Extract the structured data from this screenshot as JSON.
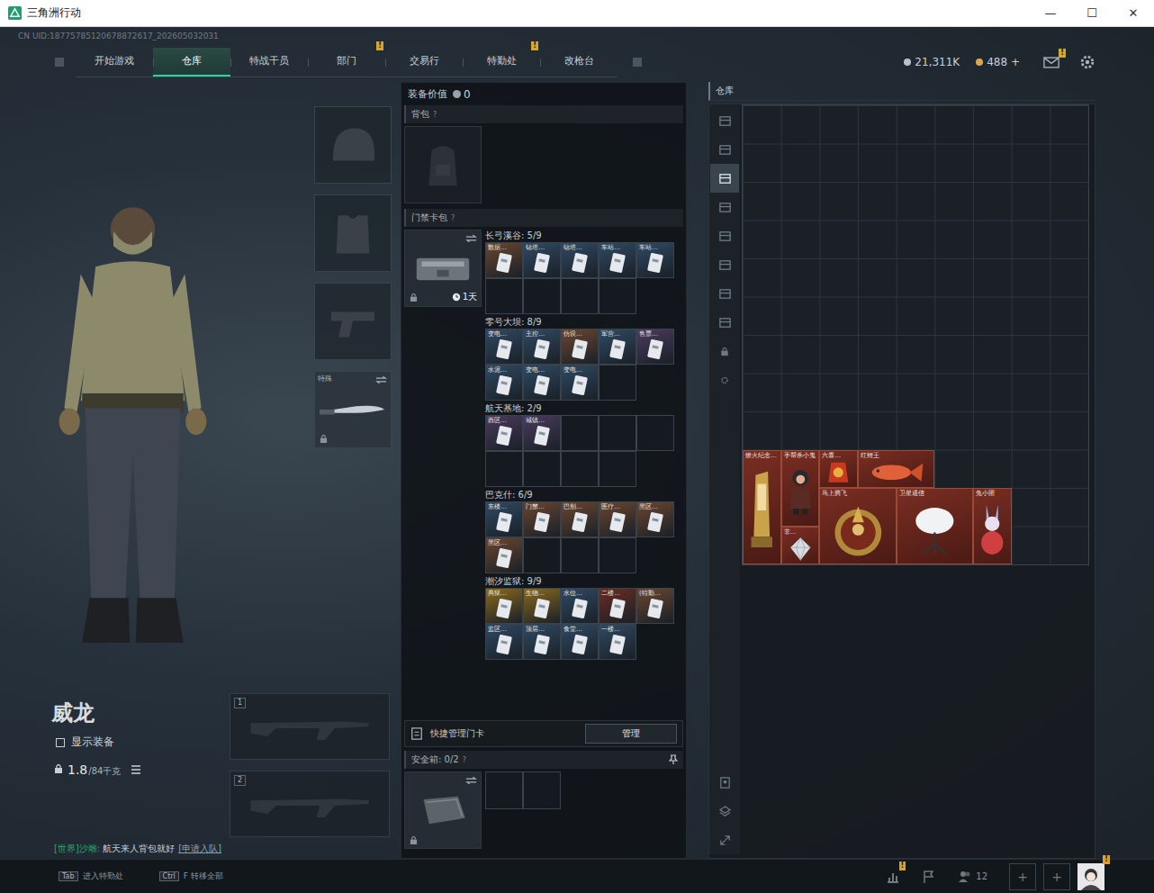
{
  "window": {
    "title": "三角洲行动",
    "controls": [
      "—",
      "☐",
      "✕"
    ]
  },
  "uid": "CN UID:18775785120678872617_202605032031",
  "nav": {
    "tabs": [
      {
        "label": "开始游戏",
        "selected": false,
        "badge": null
      },
      {
        "label": "仓库",
        "selected": true,
        "badge": null
      },
      {
        "label": "特战干员",
        "selected": false,
        "badge": null
      },
      {
        "label": "部门",
        "selected": false,
        "badge": "!"
      },
      {
        "label": "交易行",
        "selected": false,
        "badge": null
      },
      {
        "label": "特勤处",
        "selected": false,
        "badge": "!"
      },
      {
        "label": "改枪台",
        "selected": false,
        "badge": null
      }
    ]
  },
  "currency": [
    {
      "amount": "21,311K",
      "color": "#b9c2ca"
    },
    {
      "amount": "488 +",
      "color": "#d8a84a"
    }
  ],
  "mail_badge": "!",
  "character": {
    "name": "威龙",
    "show_gear": {
      "label": "显示装备",
      "checked": false
    },
    "weight": "1.8",
    "weight_max": "/84千克",
    "melee_label": "特殊"
  },
  "weapon_slots": [
    "1",
    "2"
  ],
  "chat": {
    "channel": "[世界]沙雕:",
    "text": "航天来人背包就好",
    "action": "[申请入队]"
  },
  "loadout": {
    "value_label": "装备价值",
    "value": "0",
    "backpack": {
      "label": "背包",
      "help": "?"
    },
    "keycard_case": {
      "label": "门禁卡包",
      "help": "?",
      "timer": "1天"
    },
    "groups": [
      {
        "name": "长弓溪谷:",
        "count": "5/9",
        "cards": [
          {
            "label": "数据…",
            "color": "#6a4630"
          },
          {
            "label": "钻塔…",
            "color": "#2f4a63"
          },
          {
            "label": "钻塔…",
            "color": "#2f4a63"
          },
          {
            "label": "车站…",
            "color": "#2f4a63"
          },
          {
            "label": "车站…",
            "color": "#2f4a63"
          }
        ]
      },
      {
        "name": "零号大坝:",
        "count": "8/9",
        "cards": [
          {
            "label": "变电…",
            "color": "#2f4a63"
          },
          {
            "label": "主控…",
            "color": "#2f4a63"
          },
          {
            "label": "仿设…",
            "color": "#6a4630"
          },
          {
            "label": "军营…",
            "color": "#2f4a63"
          },
          {
            "label": "售票…",
            "color": "#4a3b5e"
          },
          {
            "label": "水泥…",
            "color": "#2f4a63"
          },
          {
            "label": "变电…",
            "color": "#2f4a63"
          },
          {
            "label": "变电…",
            "color": "#2f4a63"
          }
        ]
      },
      {
        "name": "航天基地:",
        "count": "2/9",
        "cards": [
          {
            "label": "西区…",
            "color": "#4a3b5e"
          },
          {
            "label": "城镇…",
            "color": "#4a3b5e"
          }
        ]
      },
      {
        "name": "巴克什:",
        "count": "6/9",
        "cards": [
          {
            "label": "东楼…",
            "color": "#2f4a63"
          },
          {
            "label": "门禁…",
            "color": "#6a4630"
          },
          {
            "label": "巴别…",
            "color": "#6a4630"
          },
          {
            "label": "医疗…",
            "color": "#6a4630"
          },
          {
            "label": "黑区…",
            "color": "#6a4630"
          },
          {
            "label": "黑区…",
            "color": "#6a4630"
          }
        ]
      },
      {
        "name": "潮汐监狱:",
        "count": "9/9",
        "cards": [
          {
            "label": "典狱…",
            "color": "#8a6a1c"
          },
          {
            "label": "生物…",
            "color": "#8a6a1c"
          },
          {
            "label": "水位…",
            "color": "#2f4a63"
          },
          {
            "label": "二楼…",
            "color": "#6a2c22"
          },
          {
            "label": "(特勤…",
            "color": "#6a4630"
          },
          {
            "label": "监区…",
            "color": "#2f4a63"
          },
          {
            "label": "顶层…",
            "color": "#2f4a63"
          },
          {
            "label": "食堂…",
            "color": "#2f4a63"
          },
          {
            "label": "一楼…",
            "color": "#2f4a63"
          }
        ]
      }
    ],
    "quick": {
      "label": "快捷管理门卡",
      "button": "管理"
    },
    "safebox": {
      "label": "安全箱:",
      "count": "0/2",
      "help": "?"
    }
  },
  "warehouse": {
    "title": "仓库",
    "side_tabs": [
      {
        "selected": false
      },
      {
        "selected": false
      },
      {
        "selected": true
      },
      {
        "selected": false
      },
      {
        "selected": false
      },
      {
        "selected": false
      },
      {
        "selected": false
      },
      {
        "selected": false
      }
    ],
    "items": [
      {
        "label": "燎火纪念…",
        "kind": "trophy"
      },
      {
        "label": "手帮杀小鬼",
        "kind": "figure"
      },
      {
        "label": "六喜…",
        "kind": "charm"
      },
      {
        "label": "红鲤王",
        "kind": "fish"
      },
      {
        "label": "非…",
        "kind": "gem"
      },
      {
        "label": "马上腾飞",
        "kind": "compass"
      },
      {
        "label": "卫星通信",
        "kind": "dish"
      },
      {
        "label": "兔小团",
        "kind": "egg"
      }
    ]
  },
  "bottom_bar": {
    "hints": [
      {
        "key": "Tab",
        "label": "进入特勤处"
      },
      {
        "key": "Ctrl",
        "label": "F 转移全部"
      }
    ],
    "stats_badge": "!",
    "friends": "12",
    "invite": [
      "+",
      "+"
    ],
    "avatar_badge": "!"
  }
}
